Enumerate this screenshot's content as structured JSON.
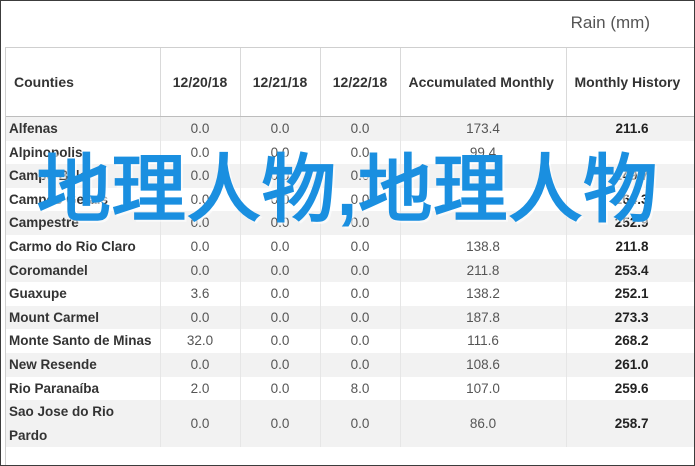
{
  "caption": "Rain (mm)",
  "headers": [
    "Counties",
    "12/20/18",
    "12/21/18",
    "12/22/18",
    "Accumulated Monthly",
    "Monthly History"
  ],
  "rows": [
    [
      "Alfenas",
      "0.0",
      "0.0",
      "0.0",
      "173.4",
      "211.6"
    ],
    [
      "Alpinopolis",
      "0.0",
      "0.0",
      "0.0",
      "99.4",
      ""
    ],
    [
      "Campo Belo",
      "0.0",
      "0.0",
      "0.0",
      "",
      "249.7"
    ],
    [
      "Campos Gerais",
      "0.0",
      "0.0",
      "0.0",
      "",
      "264.3"
    ],
    [
      "Campestre",
      "0.0",
      "0.0",
      "0.0",
      "",
      "252.9"
    ],
    [
      "Carmo do Rio Claro",
      "0.0",
      "0.0",
      "0.0",
      "138.8",
      "211.8"
    ],
    [
      "Coromandel",
      "0.0",
      "0.0",
      "0.0",
      "211.8",
      "253.4"
    ],
    [
      "Guaxupe",
      "3.6",
      "0.0",
      "0.0",
      "138.2",
      "252.1"
    ],
    [
      "Mount Carmel",
      "0.0",
      "0.0",
      "0.0",
      "187.8",
      "273.3"
    ],
    [
      "Monte Santo de Minas",
      "32.0",
      "0.0",
      "0.0",
      "111.6",
      "268.2"
    ],
    [
      "New Resende",
      "0.0",
      "0.0",
      "0.0",
      "108.6",
      "261.0"
    ],
    [
      "Rio Paranaíba",
      "2.0",
      "0.0",
      "8.0",
      "107.0",
      "259.6"
    ],
    [
      "Sao Jose do Rio Pardo",
      "0.0",
      "0.0",
      "0.0",
      "86.0",
      "258.7"
    ]
  ],
  "watermark": "地理人物,地理人物",
  "colors": {
    "watermark": "#1a8fe0",
    "frame_border": "#3c3c3c",
    "row_stripe": "#f2f2f2"
  }
}
